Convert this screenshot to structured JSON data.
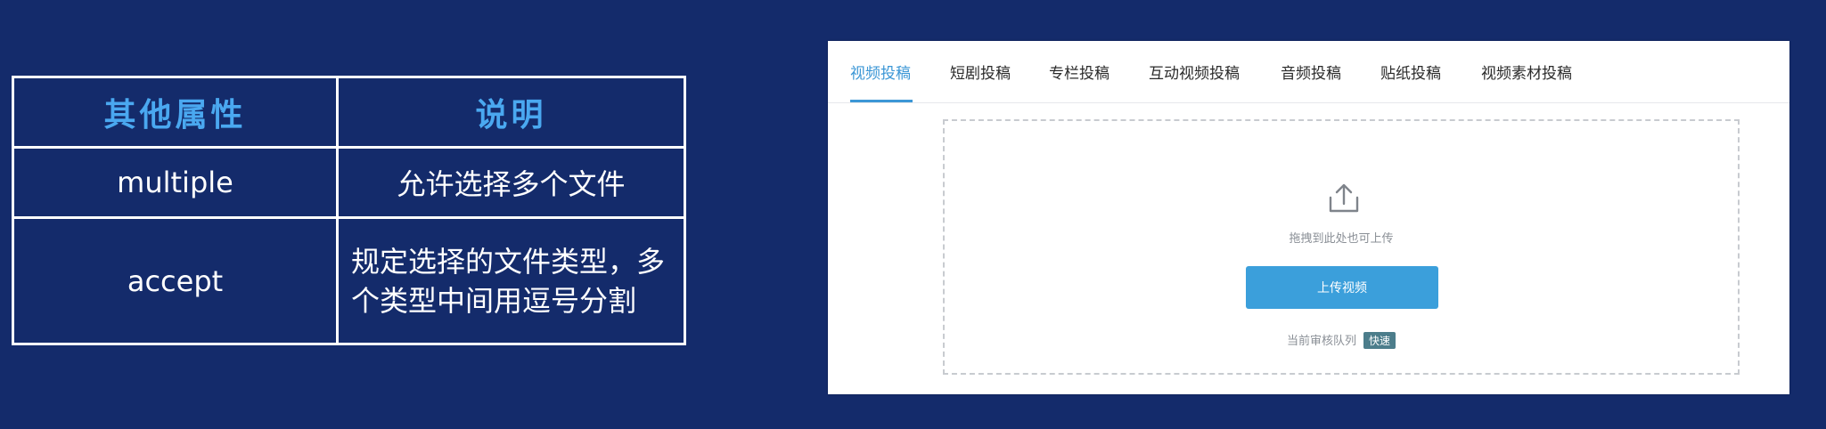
{
  "table": {
    "headers": [
      "其他属性",
      "说明"
    ],
    "rows": [
      {
        "attr": "multiple",
        "desc": "允许选择多个文件"
      },
      {
        "attr": "accept",
        "desc": "规定选择的文件类型，多个类型中间用逗号分割"
      }
    ]
  },
  "upload_panel": {
    "tabs": [
      "视频投稿",
      "短剧投稿",
      "专栏投稿",
      "互动视频投稿",
      "音频投稿",
      "贴纸投稿",
      "视频素材投稿"
    ],
    "active_tab": "视频投稿",
    "upload_icon": "upload-tray-icon",
    "drop_hint": "拖拽到此处也可上传",
    "upload_button": "上传视频",
    "queue_label": "当前审核队列",
    "queue_badge": "快速"
  },
  "colors": {
    "background": "#142b6b",
    "header_text": "#4aa8f0",
    "accent": "#3c97d6",
    "button": "#3b9fdb",
    "badge": "#4c7d8b"
  }
}
